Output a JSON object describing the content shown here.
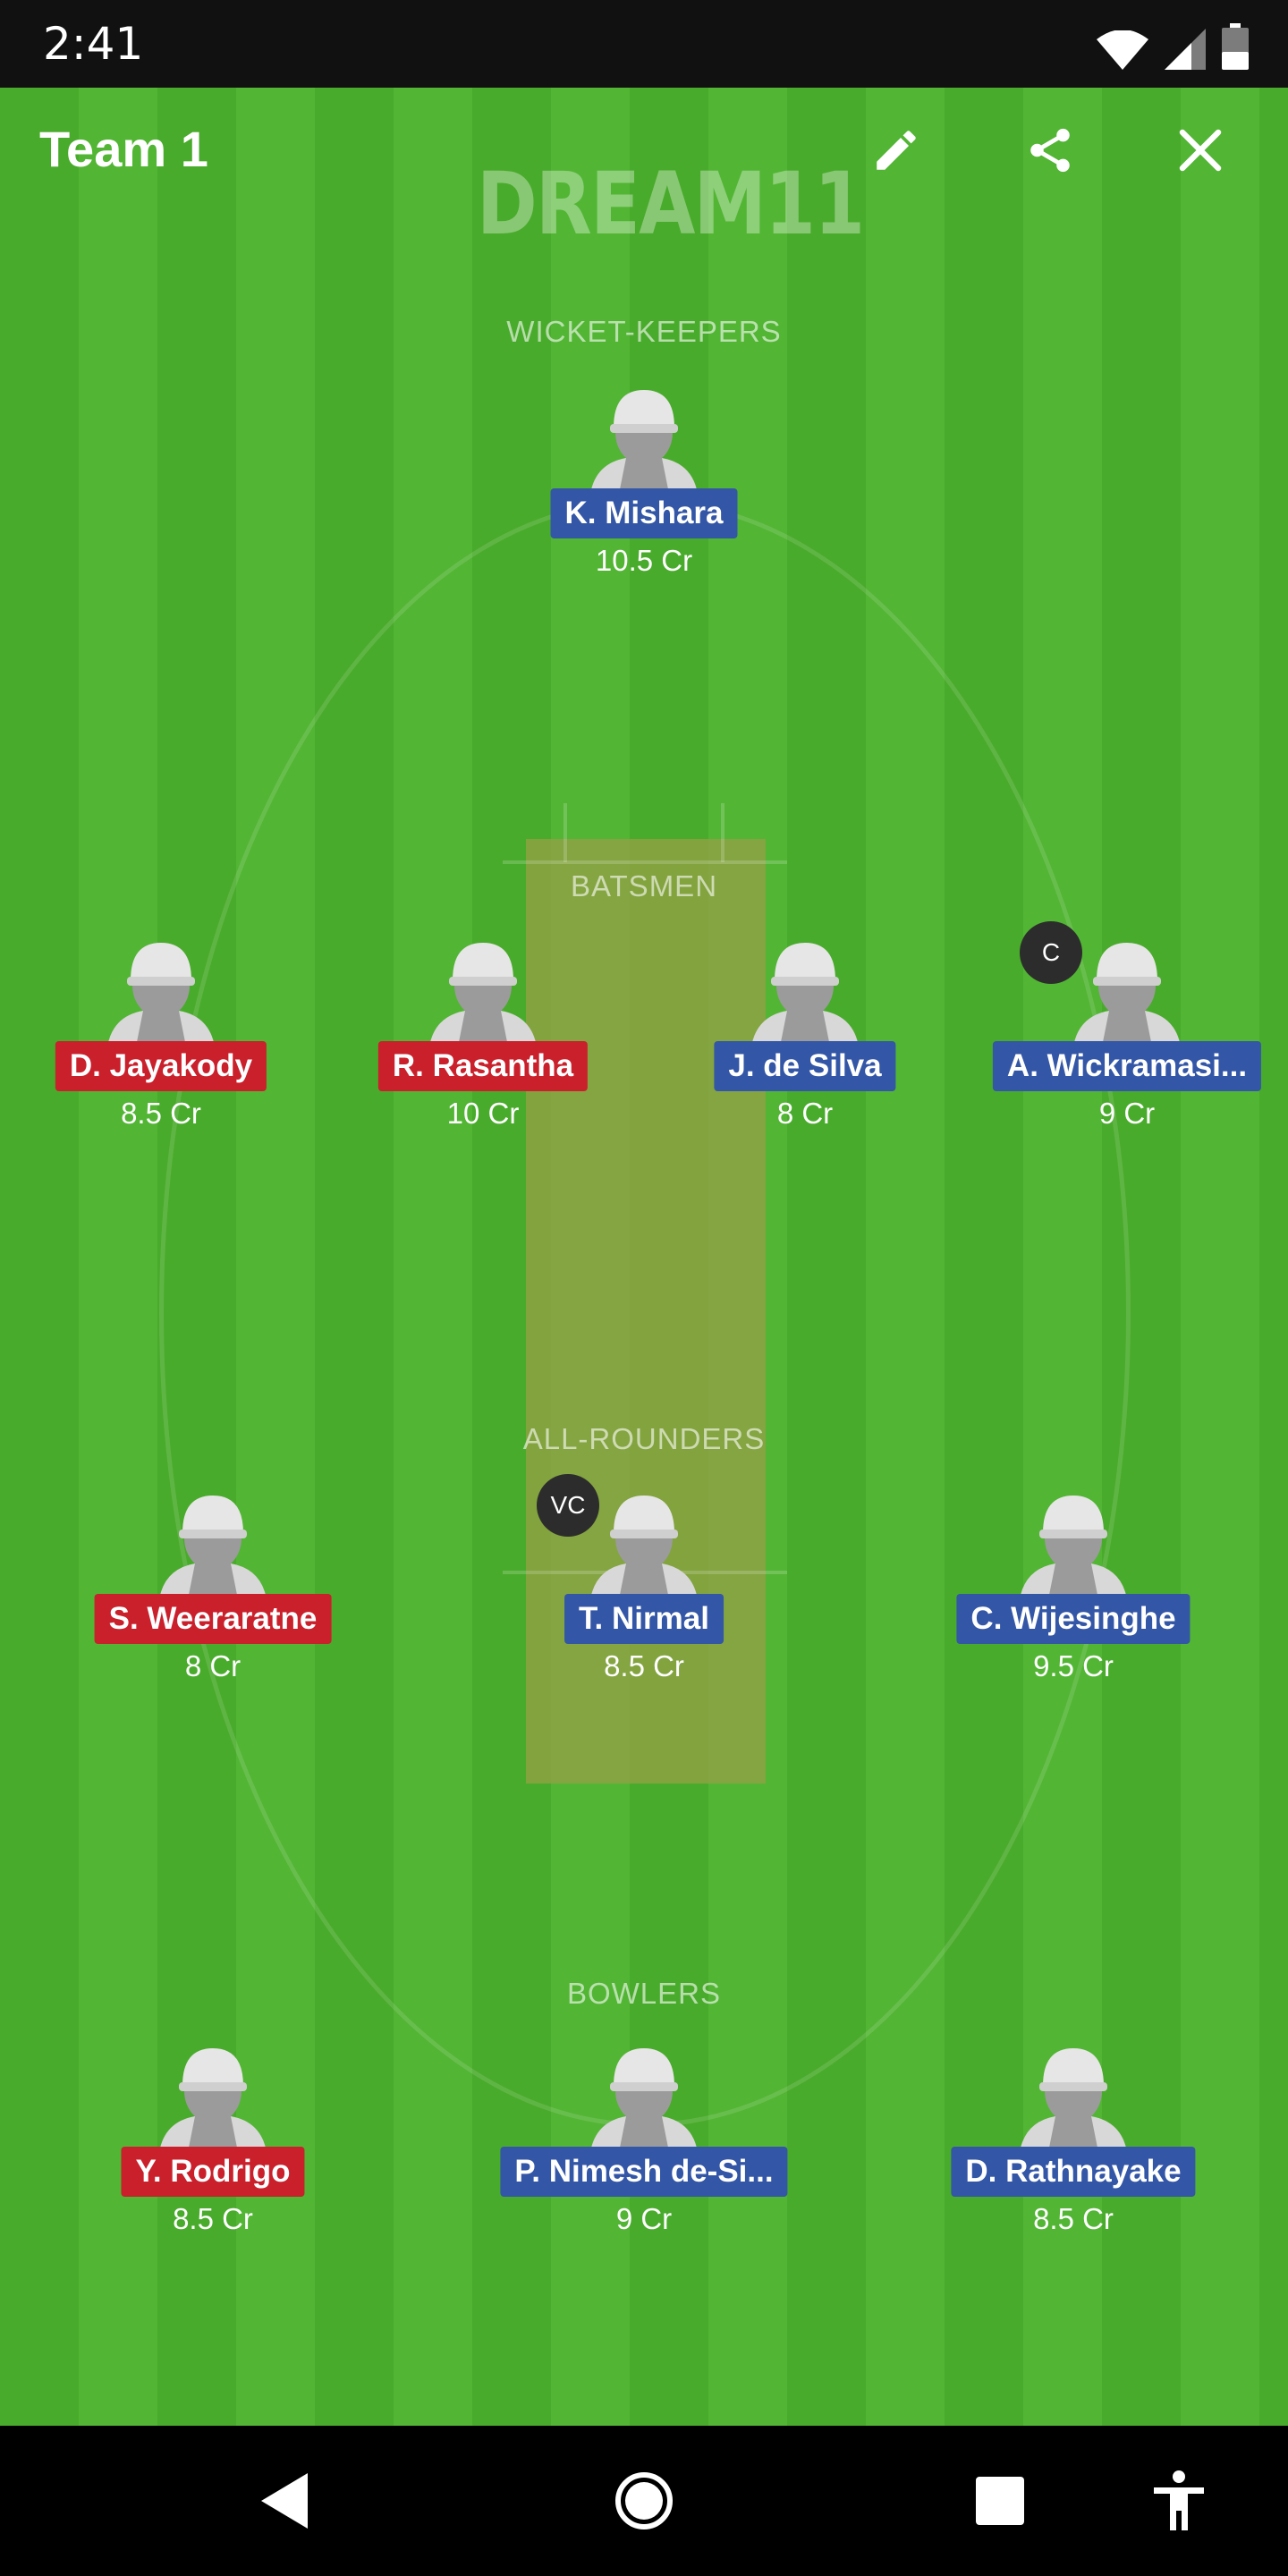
{
  "status_bar": {
    "time": "2:41"
  },
  "header": {
    "team_name": "Team 1",
    "logo_text": "DREAM11"
  },
  "sections": {
    "wicket_keepers": "WICKET-KEEPERS",
    "batsmen": "BATSMEN",
    "all_rounders": "ALL-ROUNDERS",
    "bowlers": "BOWLERS"
  },
  "players": {
    "wk": [
      {
        "name": "K. Mishara",
        "credits": "10.5 Cr",
        "team_color": "blue"
      }
    ],
    "bat": [
      {
        "name": "D. Jayakody",
        "credits": "8.5 Cr",
        "team_color": "red"
      },
      {
        "name": "R. Rasantha",
        "credits": "10 Cr",
        "team_color": "red"
      },
      {
        "name": "J. de Silva",
        "credits": "8 Cr",
        "team_color": "blue"
      },
      {
        "name": "A. Wickramasi...",
        "credits": "9 Cr",
        "team_color": "blue",
        "badge": "C"
      }
    ],
    "ar": [
      {
        "name": "S. Weeraratne",
        "credits": "8 Cr",
        "team_color": "red"
      },
      {
        "name": "T. Nirmal",
        "credits": "8.5 Cr",
        "team_color": "blue",
        "badge": "VC"
      },
      {
        "name": "C. Wijesinghe",
        "credits": "9.5 Cr",
        "team_color": "blue"
      }
    ],
    "bowl": [
      {
        "name": "Y. Rodrigo",
        "credits": "8.5 Cr",
        "team_color": "red"
      },
      {
        "name": "P. Nimesh de-Si...",
        "credits": "9 Cr",
        "team_color": "blue"
      },
      {
        "name": "D. Rathnayake",
        "credits": "8.5 Cr",
        "team_color": "blue"
      }
    ]
  },
  "colors": {
    "red_team": "#c9202c",
    "blue_team": "#3356a6",
    "field": "#4aad2c",
    "badge": "#2c2c2c"
  },
  "icons": [
    "wifi-icon",
    "signal-icon",
    "battery-icon",
    "edit-icon",
    "share-icon",
    "close-icon",
    "back-icon",
    "home-icon",
    "recents-icon",
    "accessibility-icon",
    "player-avatar-icon"
  ]
}
